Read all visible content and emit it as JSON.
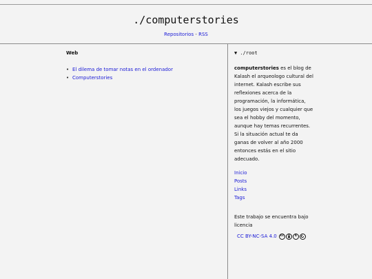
{
  "header": {
    "title": "./computerstories",
    "nav": {
      "repos": "Repositorios",
      "sep": " - ",
      "rss": "RSS"
    }
  },
  "main": {
    "section_title": "Web",
    "links": [
      "El dilema de tomar notas en el ordenador",
      "Computerstories"
    ]
  },
  "aside": {
    "root_title": "▼ ./root",
    "bio_name": "computerstories",
    "bio_text": " es el blog de Kalash el arqueologo cultural del internet. Kalash escribe sus reflexiones acerca de la programación, la informática, los juegos viejos y cualquier que sea el hobby del momento, aunque hay temas recurrentes. Si la situación actual te da ganas de volver al año 2000 entonces estás en el sitio adecuado.",
    "nav": [
      "Inicio",
      "Posts",
      "Links",
      "Tags"
    ],
    "license_text": "Este trabajo se encuentra bajo licencia",
    "license_link": "CC BY-NC-SA 4.0",
    "license_icons": [
      "cc-icon",
      "by-icon",
      "nc-icon",
      "sa-icon"
    ]
  }
}
